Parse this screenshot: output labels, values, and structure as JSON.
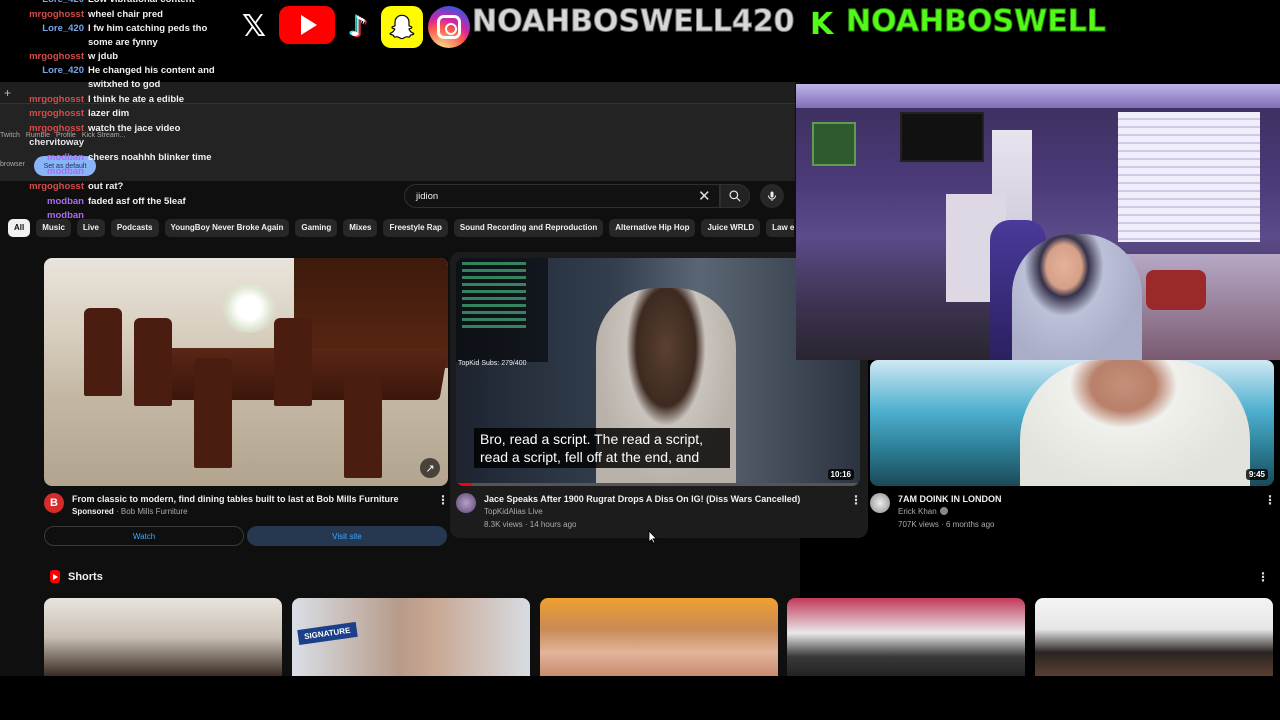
{
  "banner": {
    "icons": [
      "x-icon",
      "youtube-icon",
      "tiktok-icon",
      "snapchat-icon",
      "instagram-icon",
      "kick-icon"
    ],
    "handle_main": "NOAHBOSWELL420",
    "kick_letter": "K",
    "handle_kick": "NOAHBOSWELL"
  },
  "chat": [
    {
      "user": "Lore_420",
      "msg": "Low vibrational content",
      "color": "#7aa4e8"
    },
    {
      "user": "mrgoghosst",
      "msg": "wheel chair pred",
      "color": "#d54b4b"
    },
    {
      "user": "Lore_420",
      "msg": "I fw him catching peds tho some are fynny",
      "color": "#7aa4e8"
    },
    {
      "user": "mrgoghosst",
      "msg": "w jdub",
      "color": "#d54b4b"
    },
    {
      "user": "Lore_420",
      "msg": "He changed his content and switxhed to god",
      "color": "#7aa4e8"
    },
    {
      "user": "mrgoghosst",
      "msg": "I think he ate a edible",
      "color": "#d54b4b"
    },
    {
      "user": "mrgoghosst",
      "msg": "lazer dim",
      "color": "#d54b4b"
    },
    {
      "user": "mrgoghosst",
      "msg": "watch the jace video",
      "color": "#d54b4b"
    },
    {
      "user": "chervitoway",
      "msg": "",
      "color": "#e6e6e6"
    },
    {
      "user": "modban",
      "msg": "cheers noahhh blinker time",
      "color": "#a86bf0"
    },
    {
      "user": "modban",
      "msg": "",
      "color": "#a86bf0"
    },
    {
      "user": "mrgoghosst",
      "msg": "out rat?",
      "color": "#d54b4b"
    },
    {
      "user": "modban",
      "msg": "faded asf off the 5leaf",
      "color": "#a86bf0"
    },
    {
      "user": "modban",
      "msg": "",
      "color": "#a86bf0"
    }
  ],
  "browser": {
    "plus": "+",
    "extensions": [
      "Twitch",
      "Rumble",
      "Profile",
      "Kick Stream..."
    ],
    "browser_word": "browser",
    "default_btn": "Set as default"
  },
  "search": {
    "query": "jidion"
  },
  "chips": [
    "All",
    "Music",
    "Live",
    "Podcasts",
    "YoungBoy Never Broke Again",
    "Gaming",
    "Mixes",
    "Freestyle Rap",
    "Sound Recording and Reproduction",
    "Alternative Hip Hop",
    "Juice WRLD",
    "Law en"
  ],
  "ad": {
    "title": "From classic to modern, find dining tables built to last at Bob Mills Furniture",
    "sponsored": "Sponsored",
    "advertiser": "Bob Mills Furniture",
    "avatar_letter": "B",
    "watch": "Watch",
    "visit": "Visit site"
  },
  "video_jace": {
    "title": "Jace Speaks After 1900 Rugrat Drops A Diss On IG! (Diss Wars Cancelled)",
    "channel": "TopKidAlias Live",
    "meta": "8.3K views · 14 hours ago",
    "duration": "10:16",
    "caption": "Bro, read a script. The read a script, read a script, fell off at the end, and",
    "subs": "TopKid Subs: 279/400",
    "progress": 0.04
  },
  "video_doink": {
    "title": "7AM DOINK IN LONDON",
    "channel": "Erick Khan",
    "meta": "707K views · 6 months ago",
    "duration": "9:45"
  },
  "shorts": {
    "title": "Shorts",
    "short2_sign": "SIGNATURE"
  }
}
